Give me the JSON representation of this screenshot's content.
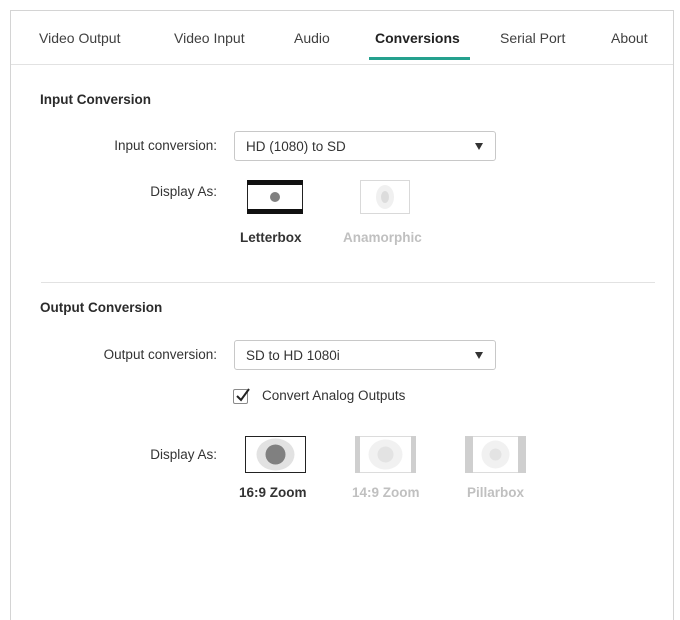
{
  "tabs": [
    {
      "label": "Video Output"
    },
    {
      "label": "Video Input"
    },
    {
      "label": "Audio"
    },
    {
      "label": "Conversions",
      "active": true
    },
    {
      "label": "Serial Port"
    },
    {
      "label": "About"
    }
  ],
  "input_section": {
    "title": "Input Conversion",
    "conversion_label": "Input conversion:",
    "conversion_value": "HD (1080) to SD",
    "display_label": "Display As:",
    "modes": [
      {
        "label": "Letterbox",
        "selected": true
      },
      {
        "label": "Anamorphic",
        "selected": false
      }
    ]
  },
  "output_section": {
    "title": "Output Conversion",
    "conversion_label": "Output conversion:",
    "conversion_value": "SD to HD 1080i",
    "analog_checkbox_label": "Convert Analog Outputs",
    "analog_checked": true,
    "display_label": "Display As:",
    "modes": [
      {
        "label": "16:9 Zoom",
        "selected": true
      },
      {
        "label": "14:9 Zoom",
        "selected": false
      },
      {
        "label": "Pillarbox",
        "selected": false
      }
    ]
  },
  "colors": {
    "accent": "#25a18e",
    "disabled": "#c0c0c0"
  }
}
